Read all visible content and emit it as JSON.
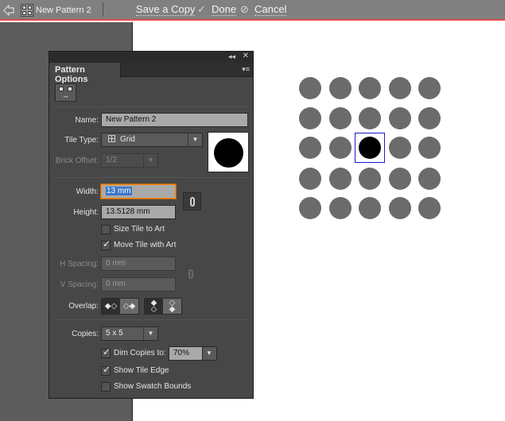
{
  "topbar": {
    "document_title": "New Pattern 2",
    "save_copy_label": "Save a Copy",
    "done_label": "Done",
    "cancel_label": "Cancel",
    "accent_color": "#e24a4a"
  },
  "panel": {
    "tab_label": "Pattern Options",
    "collapse_glyph": "◂◂",
    "close_glyph": "✕",
    "menu_glyph": "▾≡",
    "name": {
      "label": "Name:",
      "value": "New Pattern 2"
    },
    "tile_type": {
      "label": "Tile Type:",
      "value": "Grid"
    },
    "brick_offset": {
      "label": "Brick Offset:",
      "value": "1/2",
      "enabled": false
    },
    "width": {
      "label": "Width:",
      "value": "13 mm"
    },
    "height": {
      "label": "Height:",
      "value": "13.5128 mm"
    },
    "size_tile_to_art": {
      "label": "Size Tile to Art",
      "checked": false
    },
    "move_tile_with_art": {
      "label": "Move Tile with Art",
      "checked": true
    },
    "h_spacing": {
      "label": "H Spacing:",
      "value": "0 mm",
      "enabled": false
    },
    "v_spacing": {
      "label": "V Spacing:",
      "value": "0 mm",
      "enabled": false
    },
    "overlap": {
      "label": "Overlap:",
      "horizontal_selected": "left-in-front",
      "vertical_selected": "top-in-front"
    },
    "copies": {
      "label": "Copies:",
      "value": "5 x 5"
    },
    "dim_copies": {
      "label": "Dim Copies to:",
      "checked": true,
      "value": "70%"
    },
    "show_tile_edge": {
      "label": "Show Tile Edge",
      "checked": true
    },
    "show_swatch_bounds": {
      "label": "Show Swatch Bounds",
      "checked": false
    },
    "checkmark_glyph": "✓",
    "dropdown_arrow_glyph": "▼"
  },
  "artboard": {
    "grid_rows": 5,
    "grid_cols": 5,
    "original_tile": {
      "row": 2,
      "col": 2
    },
    "copy_color": "#6b6b6b",
    "original_color": "#000000",
    "tile_edge_color": "#1a1ad0"
  }
}
